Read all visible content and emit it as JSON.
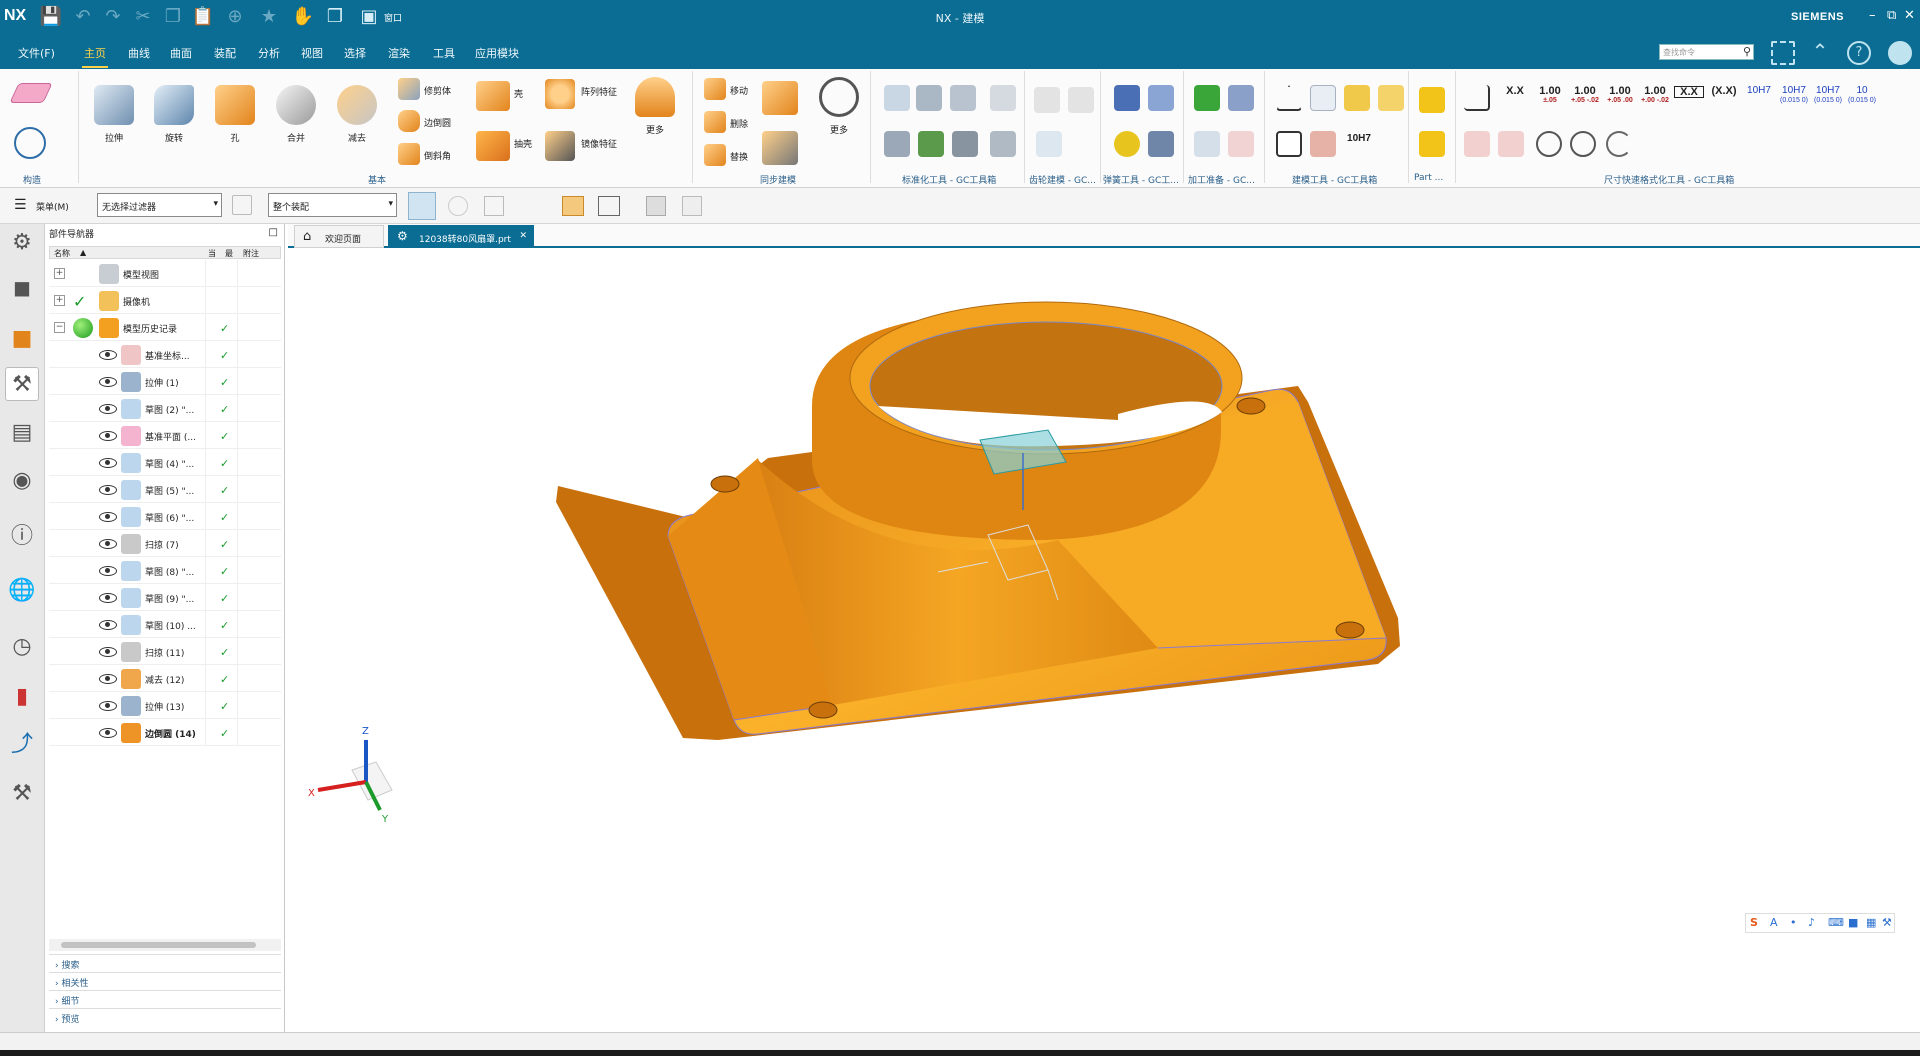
{
  "app": {
    "logo": "NX",
    "window_title": "NX - 建模",
    "brand": "SIEMENS"
  },
  "menu": {
    "items": [
      "文件(F)",
      "主页",
      "曲线",
      "曲面",
      "装配",
      "分析",
      "视图",
      "选择",
      "渲染",
      "工具",
      "应用模块"
    ],
    "active": "主页",
    "search_placeholder": "查找命令"
  },
  "quick_access": {
    "window_label": "窗口"
  },
  "ribbon": {
    "groups": [
      "构造",
      "基本",
      "同步建模",
      "标准化工具 - GC工具箱",
      "齿轮建模 - GC...",
      "弹簧工具 - GC工...",
      "加工准备 - GC...",
      "建模工具 - GC工具箱",
      "Part ...",
      "尺寸快速格式化工具 - GC工具箱"
    ],
    "basic_large": [
      "拉伸",
      "旋转",
      "孔",
      "合并",
      "减去"
    ],
    "basic_small": [
      "修剪体",
      "边倒圆",
      "倒斜角",
      "抽壳",
      "壳",
      "阵列特征",
      "镜像特征"
    ],
    "basic_more": "更多",
    "sync_small": [
      "移动",
      "删除",
      "替换"
    ],
    "sync_more": "更多",
    "dim_formats": [
      {
        "main": "X.X",
        "sub": ""
      },
      {
        "main": "1.00",
        "sub": "±.05"
      },
      {
        "main": "1.00",
        "sub": "+.05 -.02"
      },
      {
        "main": "1.00",
        "sub": "+.05 .00"
      },
      {
        "main": "1.00",
        "sub": "+.00 -.02"
      },
      {
        "main": "X.X",
        "sub": ""
      },
      {
        "main": "(X.X)",
        "sub": ""
      },
      {
        "main": "10H7",
        "sub": ""
      },
      {
        "main": "10H7",
        "sub": "(0.015 0)"
      },
      {
        "main": "10H7",
        "sub": "(0.015 0)"
      },
      {
        "main": "10",
        "sub": "(0.015 0)"
      }
    ],
    "gear_tool_label": "10H7"
  },
  "toolbar2": {
    "menu_label": "菜单(M)",
    "filter_value": "无选择过滤器",
    "scope_value": "整个装配"
  },
  "navigator": {
    "title": "部件导航器",
    "columns": [
      "名称",
      "当",
      "最",
      "附注"
    ],
    "rows": [
      {
        "label": "模型视图",
        "level": 0,
        "expand": "+",
        "kind": "view"
      },
      {
        "label": "摄像机",
        "level": 0,
        "expand": "+",
        "kind": "camera"
      },
      {
        "label": "模型历史记录",
        "level": 0,
        "expand": "−",
        "kind": "history"
      },
      {
        "label": "基准坐标...",
        "level": 1,
        "kind": "datum-csys"
      },
      {
        "label": "拉伸 (1)",
        "level": 1,
        "kind": "extrude"
      },
      {
        "label": "草图 (2) \"...",
        "level": 1,
        "kind": "sketch"
      },
      {
        "label": "基准平面 (...",
        "level": 1,
        "kind": "datum-plane"
      },
      {
        "label": "草图 (4) \"...",
        "level": 1,
        "kind": "sketch"
      },
      {
        "label": "草图 (5) \"...",
        "level": 1,
        "kind": "sketch"
      },
      {
        "label": "草图 (6) \"...",
        "level": 1,
        "kind": "sketch"
      },
      {
        "label": "扫掠 (7)",
        "level": 1,
        "kind": "sweep"
      },
      {
        "label": "草图 (8) \"...",
        "level": 1,
        "kind": "sketch"
      },
      {
        "label": "草图 (9) \"...",
        "level": 1,
        "kind": "sketch"
      },
      {
        "label": "草图 (10) ...",
        "level": 1,
        "kind": "sketch"
      },
      {
        "label": "扫掠 (11)",
        "level": 1,
        "kind": "sweep"
      },
      {
        "label": "减去 (12)",
        "level": 1,
        "kind": "subtract"
      },
      {
        "label": "拉伸 (13)",
        "level": 1,
        "kind": "extrude"
      },
      {
        "label": "边倒圆 (14)",
        "level": 1,
        "kind": "blend"
      }
    ],
    "sections": [
      "搜索",
      "相关性",
      "细节",
      "预览"
    ]
  },
  "tabs": [
    {
      "label": "欢迎页面",
      "active": false
    },
    {
      "label": "12038转80风扇罩.prt",
      "active": true
    }
  ],
  "triad": {
    "x": "X",
    "y": "Y",
    "z": "Z"
  },
  "colors": {
    "accent": "#0b6d93",
    "part": "#f3a11e",
    "active_menu": "#ffd24a"
  }
}
